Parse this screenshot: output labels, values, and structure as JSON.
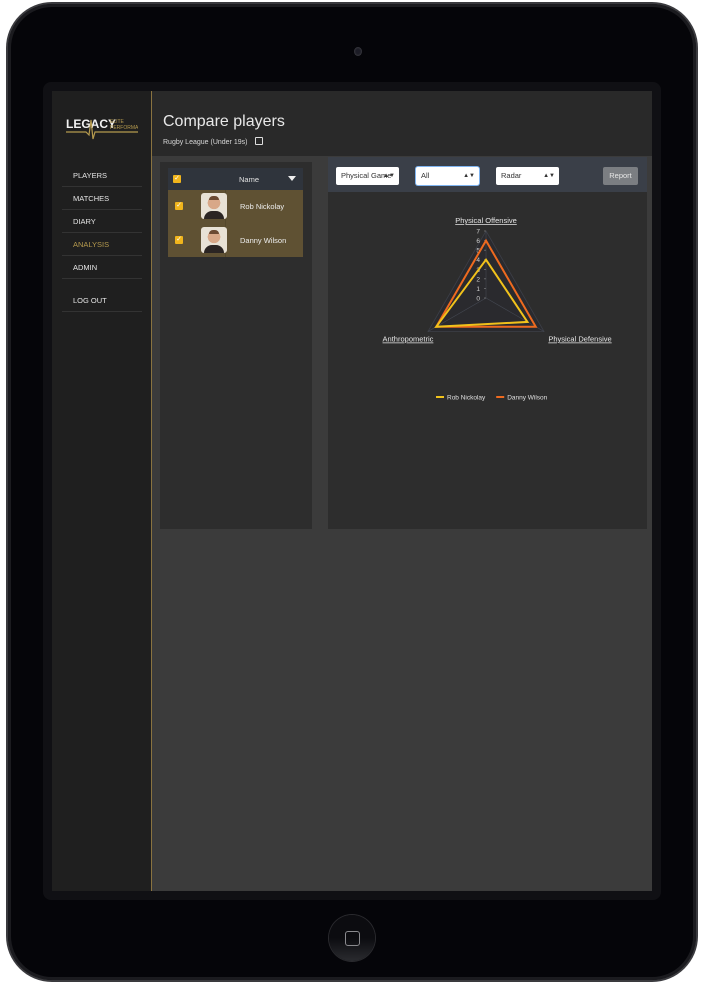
{
  "brand": {
    "logo_main": "LEGACY",
    "logo_sub1": "ELITE",
    "logo_sub2": "PERFORMANCE",
    "accent": "#b59a4e"
  },
  "sidebar": {
    "items": [
      {
        "label": "PLAYERS",
        "active": false
      },
      {
        "label": "MATCHES",
        "active": false
      },
      {
        "label": "DIARY",
        "active": false
      },
      {
        "label": "ANALYSIS",
        "active": true
      },
      {
        "label": "ADMIN",
        "active": false
      }
    ],
    "logout": "LOG OUT"
  },
  "header": {
    "title": "Compare players",
    "subtitle": "Rugby League (Under 19s)",
    "edit_icon": "edit-icon"
  },
  "players": {
    "column_name": "Name",
    "filter_icon": "filter-icon",
    "all_checked": true,
    "rows": [
      {
        "name": "Rob Nickolay",
        "checked": true
      },
      {
        "name": "Danny Wilson",
        "checked": true
      }
    ]
  },
  "toolbar": {
    "category": "Physical Game",
    "filter": "All",
    "chart_type": "Radar",
    "report_label": "Report"
  },
  "chart_data": {
    "type": "radar",
    "axes": [
      "Physical Offensive",
      "Physical Defensive",
      "Anthropometric"
    ],
    "scale": {
      "min": 0,
      "max": 7,
      "ticks": [
        "0",
        "1",
        "2",
        "3",
        "4",
        "5",
        "6",
        "7"
      ]
    },
    "series": [
      {
        "name": "Rob Nickolay",
        "color": "#f1c21b",
        "values": [
          4,
          5,
          6
        ]
      },
      {
        "name": "Danny Wilson",
        "color": "#ee6a1f",
        "values": [
          6,
          6,
          6
        ]
      }
    ],
    "legend": "bottom"
  }
}
